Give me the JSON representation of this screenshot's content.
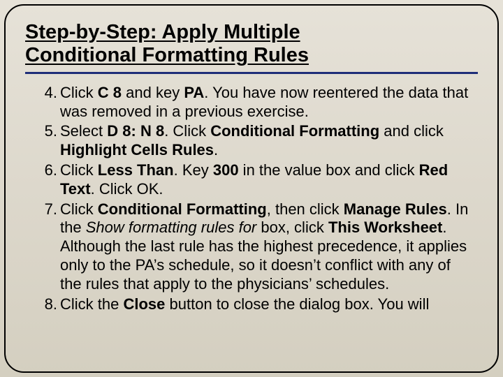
{
  "title_line1": "Step-by-Step: Apply Multiple",
  "title_line2": "Conditional Formatting Rules",
  "steps": {
    "s4": {
      "t0": "Click ",
      "b0": "C 8",
      "t1": " and key ",
      "b1": "PA",
      "t2": ". You have now reentered the data that was removed in a previous exercise."
    },
    "s5": {
      "t0": "Select ",
      "b0": "D 8: N 8",
      "t1": ". Click ",
      "b1": "Conditional Formatting",
      "t2": " and click ",
      "b2": "Highlight Cells Rules",
      "t3": "."
    },
    "s6": {
      "t0": "Click ",
      "b0": "Less Than",
      "t1": ". Key ",
      "b1": "300",
      "t2": " in the value box and click ",
      "b2": "Red Text",
      "t3": ". Click OK."
    },
    "s7": {
      "t0": "Click ",
      "b0": "Conditional Formatting",
      "t1": ", then click ",
      "b1": "Manage Rules",
      "t2": ". In the ",
      "i0": "Show formatting rules for",
      "t3": " box, click ",
      "b2": "This Worksheet",
      "t4": ". Although the last rule has the highest precedence, it applies only to the PA’s schedule, so it doesn’t conflict with any of the rules that apply to the physicians’ schedules."
    },
    "s8": {
      "t0": "Click the ",
      "b0": "Close",
      "t1": " button to close the dialog box. You will"
    }
  }
}
